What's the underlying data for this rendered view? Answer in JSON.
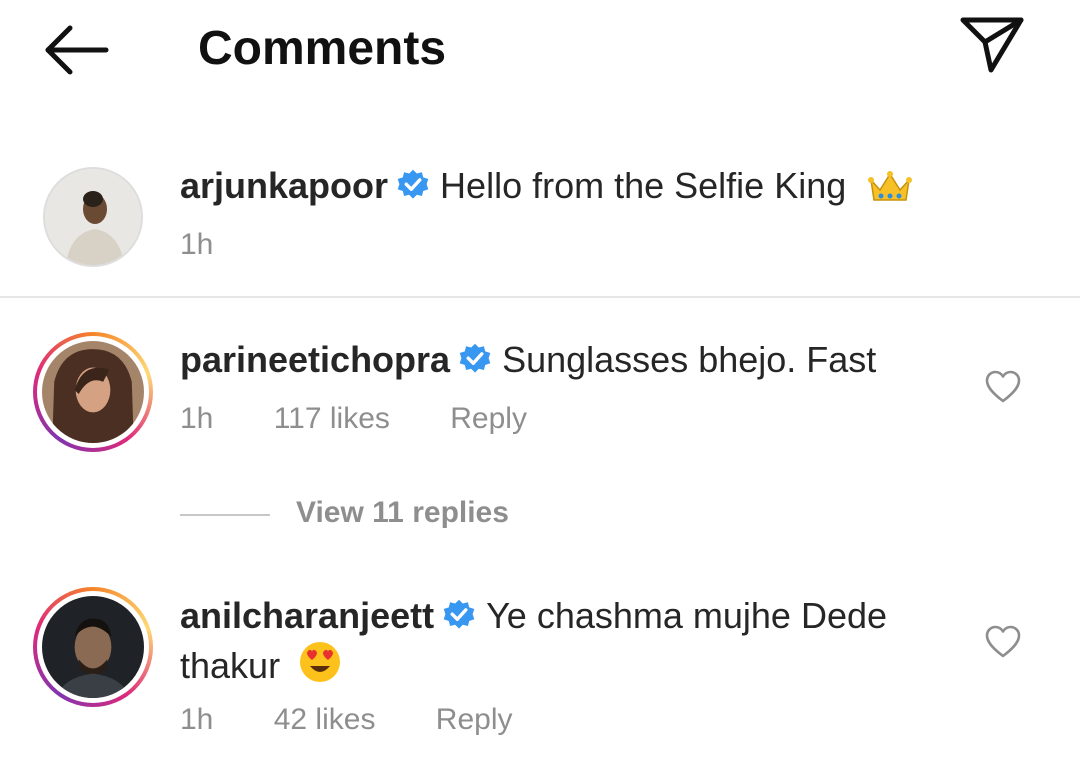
{
  "header": {
    "title": "Comments",
    "back_icon": "arrow-left-icon",
    "share_icon": "paper-plane-icon"
  },
  "caption": {
    "username": "arjunkapoor",
    "text": "Hello from the Selfie King",
    "emoji": "crown-icon",
    "time": "1h"
  },
  "comments": [
    {
      "username": "parineetichopra",
      "text": "Sunglasses bhejo. Fast",
      "time": "1h",
      "likes": "117 likes",
      "reply_label": "Reply",
      "view_replies": "View 11 replies"
    },
    {
      "username": "anilcharanjeett",
      "text_line1": "Ye chashma mujhe Dede",
      "text_line2": "thakur",
      "emoji": "heart-eyes-icon",
      "time": "1h",
      "likes": "42 likes",
      "reply_label": "Reply"
    }
  ],
  "colors": {
    "verified": "#3897f0",
    "meta": "#8e8e8e",
    "text": "#262626"
  }
}
